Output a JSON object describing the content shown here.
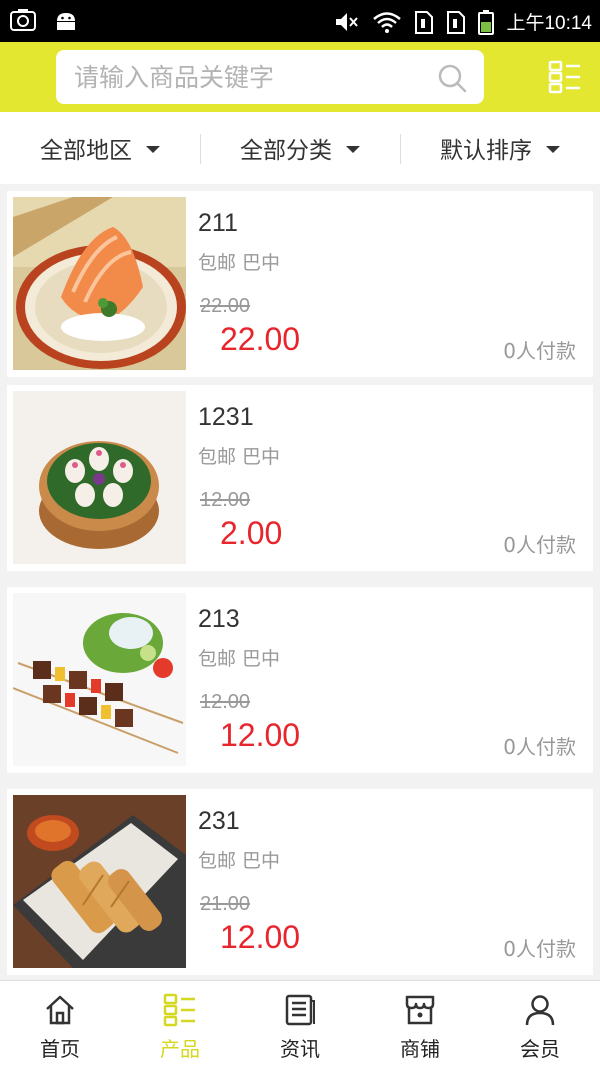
{
  "status_bar": {
    "time": "上午10:14"
  },
  "search": {
    "placeholder": "请输入商品关键字"
  },
  "filters": [
    {
      "label": "全部地区"
    },
    {
      "label": "全部分类"
    },
    {
      "label": "默认排序"
    }
  ],
  "products": [
    {
      "name": "211",
      "shipping": "包邮 巴中",
      "original_price": "22.00",
      "price": "22.00",
      "sold": "0人付款"
    },
    {
      "name": "1231",
      "shipping": "包邮 巴中",
      "original_price": "12.00",
      "price": "2.00",
      "sold": "0人付款"
    },
    {
      "name": "213",
      "shipping": "包邮 巴中",
      "original_price": "12.00",
      "price": "12.00",
      "sold": "0人付款"
    },
    {
      "name": "231",
      "shipping": "包邮 巴中",
      "original_price": "21.00",
      "price": "12.00",
      "sold": "0人付款"
    }
  ],
  "tabs": [
    {
      "label": "首页",
      "icon": "home-icon"
    },
    {
      "label": "产品",
      "icon": "grid-list-icon"
    },
    {
      "label": "资讯",
      "icon": "news-icon"
    },
    {
      "label": "商铺",
      "icon": "shop-icon"
    },
    {
      "label": "会员",
      "icon": "user-icon"
    }
  ],
  "colors": {
    "accent": "#e3e72f",
    "active_tab": "#d4d81f",
    "price": "#e8242c"
  }
}
